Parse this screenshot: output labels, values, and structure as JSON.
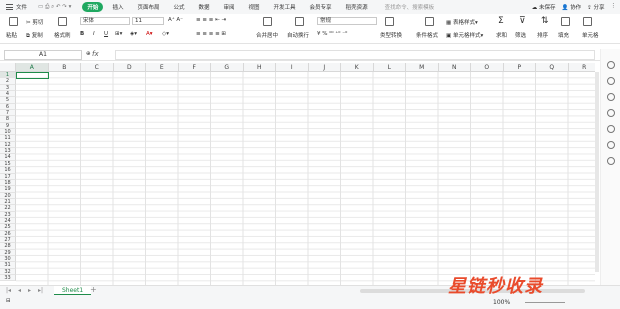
{
  "menu": {
    "file_label": "文件"
  },
  "tabs": [
    "开始",
    "插入",
    "页面布局",
    "公式",
    "数据",
    "审阅",
    "视图",
    "开发工具",
    "会员专享",
    "稻壳资源"
  ],
  "active_tab": "开始",
  "search": {
    "placeholder": "查找命令、搜索模板"
  },
  "top_right": {
    "unsaved": "未保存",
    "collab": "协作",
    "share": "分享"
  },
  "ribbon": {
    "paste": "粘贴",
    "cut": "剪切",
    "copy": "复制",
    "format_painter": "格式刷",
    "font_name": "宋体",
    "font_size": "11",
    "merge_center": "合并居中",
    "wrap_text": "自动换行",
    "number_format": "常规",
    "type_convert": "类型转换",
    "conditional_format": "条件格式",
    "table_style": "表格样式",
    "cell_style": "单元格样式",
    "sum": "求和",
    "filter": "筛选",
    "sort": "排序",
    "fill": "填充",
    "cell": "单元格"
  },
  "formula_bar": {
    "name_box": "A1",
    "fx_label": "fx",
    "value": ""
  },
  "columns": [
    "A",
    "B",
    "C",
    "D",
    "E",
    "F",
    "G",
    "H",
    "I",
    "J",
    "K",
    "L",
    "M",
    "N",
    "O",
    "P",
    "Q",
    "R"
  ],
  "rows": [
    "1",
    "2",
    "3",
    "4",
    "5",
    "6",
    "7",
    "8",
    "9",
    "10",
    "11",
    "12",
    "13",
    "14",
    "15",
    "16",
    "17",
    "18",
    "19",
    "20",
    "21",
    "22",
    "23",
    "24",
    "25",
    "26",
    "27",
    "28",
    "29",
    "30",
    "31",
    "32",
    "33"
  ],
  "active_cell": "A1",
  "sheets": [
    "Sheet1"
  ],
  "add_sheet": "+",
  "status": {
    "zoom": "100%"
  },
  "watermark": "星链秒收录",
  "colors": {
    "accent": "#1fa860",
    "watermark": "#e94b2c"
  }
}
